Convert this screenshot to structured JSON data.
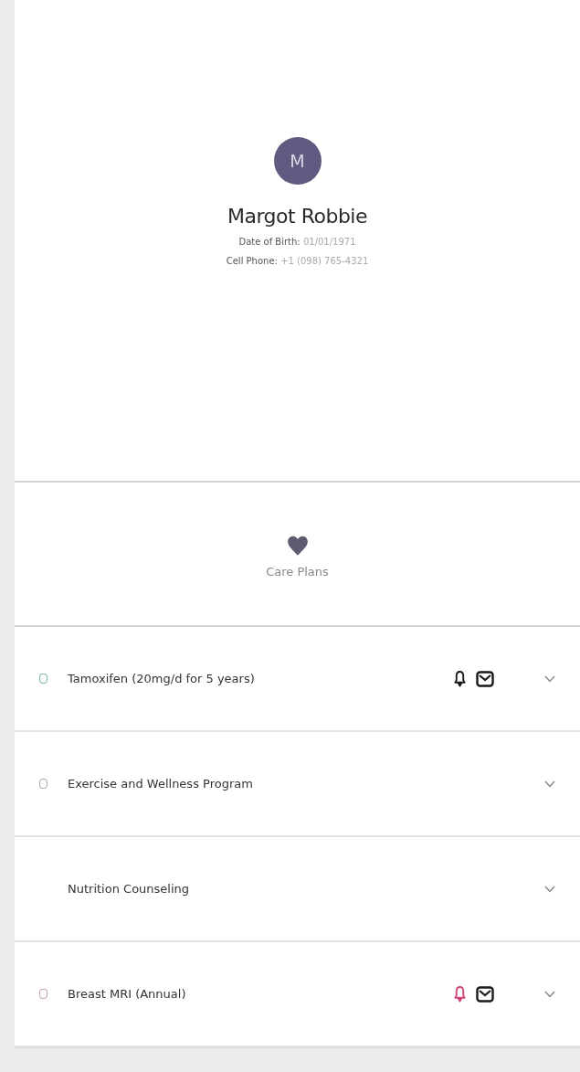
{
  "profile": {
    "initial": "M",
    "name": "Margot Robbie",
    "details": [
      {
        "label": "Date of Birth:",
        "value": "01/01/1971"
      },
      {
        "label": "Cell Phone:",
        "value": "+1 (098) 765-4321"
      }
    ]
  },
  "section": {
    "title": "Care Plans"
  },
  "care_plans": [
    {
      "title": "Tamoxifen (20mg/d for 5 years)",
      "color": "#7fb8a8",
      "bell": true,
      "bell_alert": false,
      "mail": true
    },
    {
      "title": "Exercise and Wellness Program",
      "color": "#b8a8ac",
      "bell": false,
      "mail": false
    },
    {
      "title": "Nutrition Counseling",
      "bell": false,
      "mail": false
    },
    {
      "title": "Breast MRI (Annual)",
      "color": "#c8a0ac",
      "bell": true,
      "bell_alert": true,
      "mail": true
    }
  ]
}
